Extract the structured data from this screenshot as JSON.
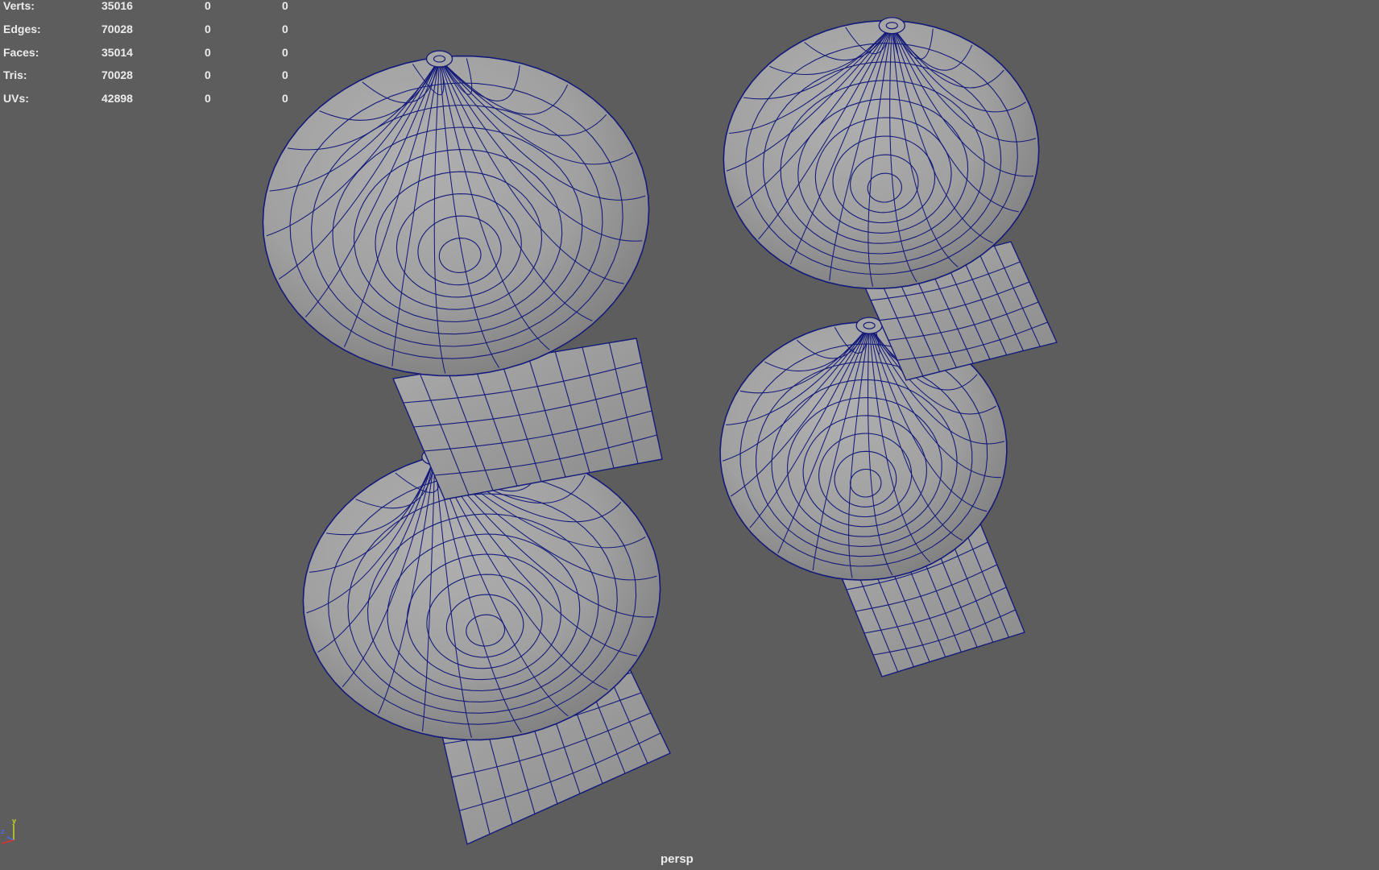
{
  "viewport": {
    "camera_label": "persp",
    "background_color": "#5d5d5d",
    "wireframe_color": "#141a7a",
    "mesh_color": "#a2a2a2"
  },
  "heads_up_display": {
    "rows": [
      {
        "label": "Verts:",
        "values": [
          "35016",
          "0",
          "0"
        ]
      },
      {
        "label": "Edges:",
        "values": [
          "70028",
          "0",
          "0"
        ]
      },
      {
        "label": "Faces:",
        "values": [
          "35014",
          "0",
          "0"
        ]
      },
      {
        "label": "Tris:",
        "values": [
          "70028",
          "0",
          "0"
        ]
      },
      {
        "label": "UVs:",
        "values": [
          "42898",
          "0",
          "0"
        ]
      }
    ]
  },
  "axis_gizmo": {
    "axes": [
      {
        "axis": "y",
        "color": "#c8d820"
      },
      {
        "axis": "z",
        "color": "#4a6cf0"
      },
      {
        "axis": "x",
        "color": "#e0302a"
      }
    ]
  }
}
